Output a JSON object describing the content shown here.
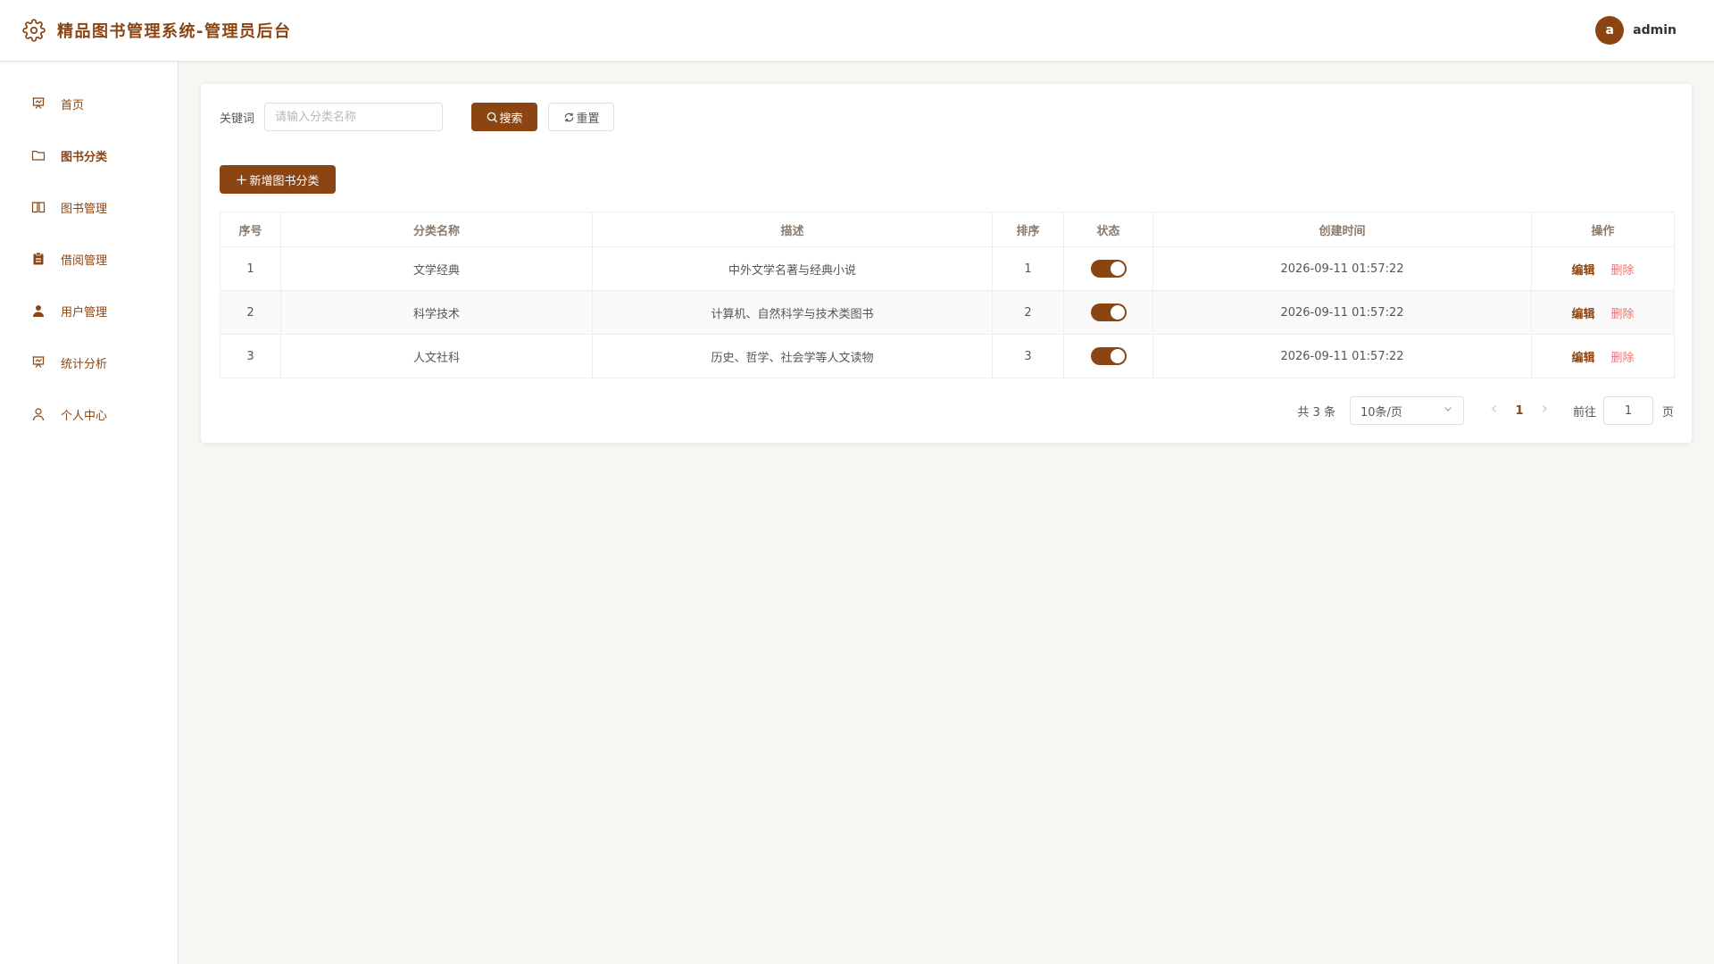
{
  "header": {
    "title": "精品图书管理系统-管理员后台",
    "logo_icon": "gear-icon",
    "avatar_letter": "a",
    "username": "admin"
  },
  "sidebar": {
    "items": [
      {
        "label": "首页",
        "icon": "presentation-chart-icon",
        "active": false
      },
      {
        "label": "图书分类",
        "icon": "folder-icon",
        "active": true
      },
      {
        "label": "图书管理",
        "icon": "book-open-icon",
        "active": false
      },
      {
        "label": "借阅管理",
        "icon": "clipboard-icon",
        "active": false
      },
      {
        "label": "用户管理",
        "icon": "user-filled-icon",
        "active": false
      },
      {
        "label": "统计分析",
        "icon": "presentation-chart-icon",
        "active": false
      },
      {
        "label": "个人中心",
        "icon": "user-outline-icon",
        "active": false
      }
    ]
  },
  "search": {
    "label": "关键词",
    "placeholder": "请输入分类名称",
    "value": "",
    "search_label": "搜索",
    "reset_label": "重置"
  },
  "toolbar": {
    "add_label": "新增图书分类"
  },
  "table": {
    "columns": [
      "序号",
      "分类名称",
      "描述",
      "排序",
      "状态",
      "创建时间",
      "操作"
    ],
    "rows": [
      {
        "index": "1",
        "name": "文学经典",
        "description": "中外文学名著与经典小说",
        "sort": "1",
        "enabled": true,
        "created": "2026-09-11 01:57:22",
        "edit": "编辑",
        "delete": "删除"
      },
      {
        "index": "2",
        "name": "科学技术",
        "description": "计算机、自然科学与技术类图书",
        "sort": "2",
        "enabled": true,
        "created": "2026-09-11 01:57:22",
        "edit": "编辑",
        "delete": "删除"
      },
      {
        "index": "3",
        "name": "人文社科",
        "description": "历史、哲学、社会学等人文读物",
        "sort": "3",
        "enabled": true,
        "created": "2026-09-11 01:57:22",
        "edit": "编辑",
        "delete": "删除"
      }
    ]
  },
  "pagination": {
    "total_text": "共 3 条",
    "page_size": "10条/页",
    "current_page": "1",
    "goto_label": "前往",
    "goto_value": "1",
    "goto_suffix": "页"
  },
  "colors": {
    "primary": "#8b4513",
    "danger": "#e57373",
    "background": "#f8f6f3"
  }
}
